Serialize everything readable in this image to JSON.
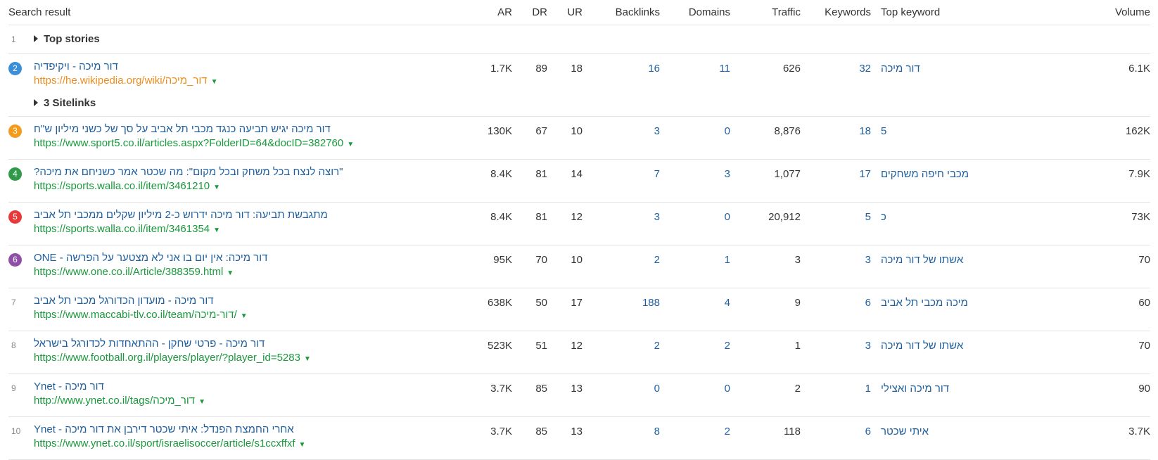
{
  "headers": {
    "result": "Search result",
    "ar": "AR",
    "dr": "DR",
    "ur": "UR",
    "backlinks": "Backlinks",
    "domains": "Domains",
    "traffic": "Traffic",
    "keywords": "Keywords",
    "top_keyword": "Top keyword",
    "volume": "Volume"
  },
  "group_row": {
    "pos": "1",
    "label": "Top stories"
  },
  "rows": [
    {
      "pos": "2",
      "badge_color": "#3b8ed8",
      "title": "דור מיכה - ויקיפדיה",
      "url": "https://he.wikipedia.org/wiki/דור_מיכה",
      "url_color": "#f08c1a",
      "ar": "1.7K",
      "dr": "89",
      "ur": "18",
      "backlinks": "16",
      "domains": "11",
      "traffic": "626",
      "keywords": "32",
      "top_keyword": "דור מיכה",
      "volume": "6.1K",
      "sitelinks": "3 Sitelinks"
    },
    {
      "pos": "3",
      "badge_color": "#f39b1d",
      "title": "דור מיכה יגיש תביעה כנגד מכבי תל אביב על סך של כשני מיליון ש\"ח",
      "url": "https://www.sport5.co.il/articles.aspx?FolderID=64&docID=382760",
      "ar": "130K",
      "dr": "67",
      "ur": "10",
      "backlinks": "3",
      "domains": "0",
      "traffic": "8,876",
      "keywords": "18",
      "top_keyword": "5",
      "volume": "162K"
    },
    {
      "pos": "4",
      "badge_color": "#2e9a4a",
      "title": "\"רוצה לנצח בכל משחק ובכל מקום\": מה שכטר אמר כשניחם את מיכה?",
      "url": "https://sports.walla.co.il/item/3461210",
      "ar": "8.4K",
      "dr": "81",
      "ur": "14",
      "backlinks": "7",
      "domains": "3",
      "traffic": "1,077",
      "keywords": "17",
      "top_keyword": "מכבי חיפה משחקים",
      "volume": "7.9K"
    },
    {
      "pos": "5",
      "badge_color": "#e8393a",
      "title": "מתגבשת תביעה: דור מיכה ידרוש כ-2 מיליון שקלים ממכבי תל אביב",
      "url": "https://sports.walla.co.il/item/3461354",
      "ar": "8.4K",
      "dr": "81",
      "ur": "12",
      "backlinks": "3",
      "domains": "0",
      "traffic": "20,912",
      "keywords": "5",
      "top_keyword": "כ",
      "volume": "73K"
    },
    {
      "pos": "6",
      "badge_color": "#8e4fa6",
      "title": "דור מיכה: אין יום בו אני לא מצטער על הפרשה - ONE",
      "url": "https://www.one.co.il/Article/388359.html",
      "ar": "95K",
      "dr": "70",
      "ur": "10",
      "backlinks": "2",
      "domains": "1",
      "traffic": "3",
      "keywords": "3",
      "top_keyword": "אשתו של דור מיכה",
      "volume": "70"
    },
    {
      "pos": "7",
      "badge_color": "",
      "title": "דור מיכה - מועדון הכדורגל מכבי תל אביב",
      "url": "https://www.maccabi-tlv.co.il/team/דור-מיכה/",
      "ar": "638K",
      "dr": "50",
      "ur": "17",
      "backlinks": "188",
      "domains": "4",
      "traffic": "9",
      "keywords": "6",
      "top_keyword": "מיכה מכבי תל אביב",
      "volume": "60"
    },
    {
      "pos": "8",
      "badge_color": "",
      "title": "דור מיכה - פרטי שחקן - ההתאחדות לכדורגל בישראל",
      "url": "https://www.football.org.il/players/player/?player_id=5283",
      "ar": "523K",
      "dr": "51",
      "ur": "12",
      "backlinks": "2",
      "domains": "2",
      "traffic": "1",
      "keywords": "3",
      "top_keyword": "אשתו של דור מיכה",
      "volume": "70"
    },
    {
      "pos": "9",
      "badge_color": "",
      "title": "דור מיכה - Ynet",
      "url": "http://www.ynet.co.il/tags/דור_מיכה",
      "ar": "3.7K",
      "dr": "85",
      "ur": "13",
      "backlinks": "0",
      "domains": "0",
      "traffic": "2",
      "keywords": "1",
      "top_keyword": "דור מיכה ואצילי",
      "volume": "90"
    },
    {
      "pos": "10",
      "badge_color": "",
      "title": "אחרי החמצת הפנדל: איתי שכטר דירבן את דור מיכה - Ynet",
      "url": "https://www.ynet.co.il/sport/israelisoccer/article/s1ccxffxf",
      "ar": "3.7K",
      "dr": "85",
      "ur": "13",
      "backlinks": "8",
      "domains": "2",
      "traffic": "118",
      "keywords": "6",
      "top_keyword": "איתי שכטר",
      "volume": "3.7K"
    }
  ],
  "icons": {
    "expand": "triangle-right-icon",
    "dropdown": "caret-down-icon"
  },
  "colors": {
    "link": "#1f5f9e",
    "url": "#1a9a3c",
    "divider": "#e3e3e3"
  }
}
